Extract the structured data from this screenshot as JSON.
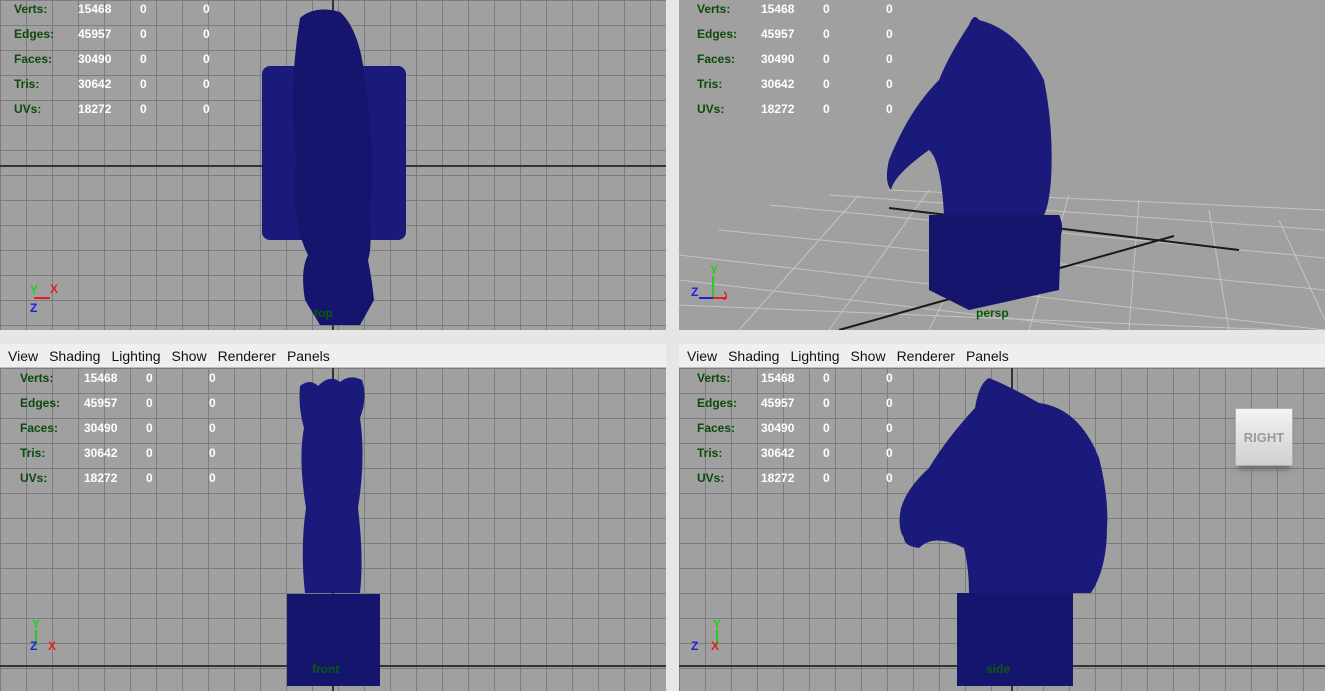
{
  "menu": [
    "View",
    "Shading",
    "Lighting",
    "Show",
    "Renderer",
    "Panels"
  ],
  "hud": [
    {
      "label": "Verts:",
      "values": [
        "15468",
        "0",
        "0"
      ]
    },
    {
      "label": "Edges:",
      "values": [
        "45957",
        "0",
        "0"
      ]
    },
    {
      "label": "Faces:",
      "values": [
        "30490",
        "0",
        "0"
      ]
    },
    {
      "label": "Tris:",
      "values": [
        "30642",
        "0",
        "0"
      ]
    },
    {
      "label": "UVs:",
      "values": [
        "18272",
        "0",
        "0"
      ]
    }
  ],
  "viewports": {
    "top": {
      "camera": "top"
    },
    "persp": {
      "camera": "persp"
    },
    "front": {
      "camera": "front"
    },
    "side": {
      "camera": "side"
    }
  },
  "viewcube_label": "RIGHT",
  "axes": {
    "x": "X",
    "y": "Y",
    "z": "Z"
  },
  "colors": {
    "mesh": "#1a1a7a",
    "viewport_bg": "#a0a0a0",
    "hud_label": "#0a4a0a",
    "hud_value": "#ffffff",
    "axis_x": "#e02020",
    "axis_y": "#20d020",
    "axis_z": "#2020e0"
  }
}
